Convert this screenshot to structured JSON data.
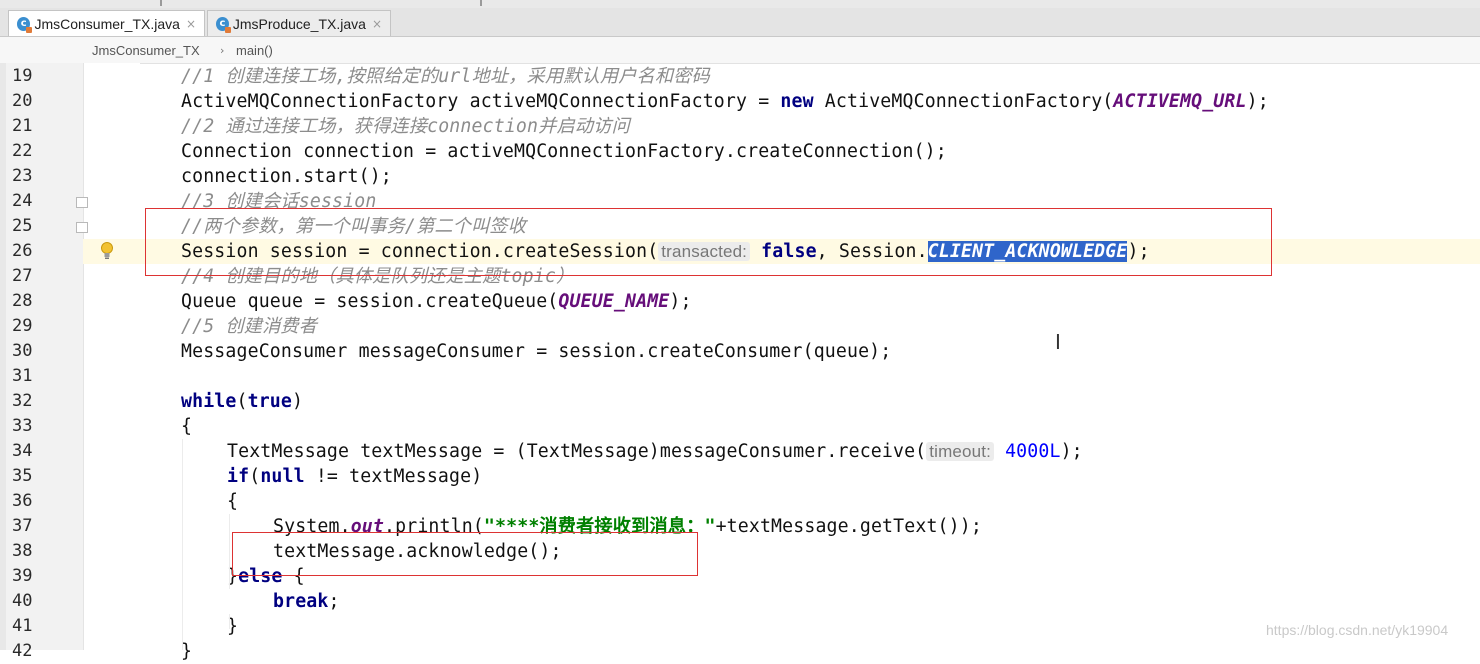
{
  "tabs": [
    {
      "label": "JmsConsumer_TX.java",
      "active": true
    },
    {
      "label": "JmsProduce_TX.java",
      "active": false
    }
  ],
  "tab_close_glyph": "×",
  "breadcrumb": {
    "class_name": "JmsConsumer_TX",
    "separator": "›",
    "method": "main()"
  },
  "lines": [
    {
      "n": "19",
      "indent": 0,
      "parts": [
        {
          "t": "//1 创建连接工场,按照给定的url地址，采用默认用户名和密码",
          "c": "cm"
        }
      ]
    },
    {
      "n": "20",
      "indent": 0,
      "parts": [
        {
          "t": "ActiveMQConnectionFactory activeMQConnectionFactory = "
        },
        {
          "t": "new",
          "c": "kw"
        },
        {
          "t": " ActiveMQConnectionFactory("
        },
        {
          "t": "ACTIVEMQ_URL",
          "c": "cst"
        },
        {
          "t": ");"
        }
      ]
    },
    {
      "n": "21",
      "indent": 0,
      "parts": [
        {
          "t": "//2 通过连接工场，获得连接connection并启动访问",
          "c": "cm"
        }
      ]
    },
    {
      "n": "22",
      "indent": 0,
      "parts": [
        {
          "t": "Connection connection = activeMQConnectionFactory.createConnection();"
        }
      ]
    },
    {
      "n": "23",
      "indent": 0,
      "parts": [
        {
          "t": "connection.start();"
        }
      ]
    },
    {
      "n": "24",
      "indent": 0,
      "parts": [
        {
          "t": "//3 创建会话session",
          "c": "cm"
        }
      ]
    },
    {
      "n": "25",
      "indent": 0,
      "parts": [
        {
          "t": "//两个参数，第一个叫事务/第二个叫签收",
          "c": "cm"
        }
      ]
    },
    {
      "n": "26",
      "indent": 0,
      "parts": [
        {
          "t": "Session session = connection.createSession("
        },
        {
          "t": "transacted:",
          "c": "hint"
        },
        {
          "t": " "
        },
        {
          "t": "false",
          "c": "kw"
        },
        {
          "t": ", Session."
        },
        {
          "t": "CLIENT_ACKNOWLEDGE",
          "c": "sel"
        },
        {
          "t": ");"
        }
      ]
    },
    {
      "n": "27",
      "indent": 0,
      "parts": [
        {
          "t": "//4 创建目的地（具体是队列还是主题topic）",
          "c": "cm"
        }
      ]
    },
    {
      "n": "28",
      "indent": 0,
      "parts": [
        {
          "t": "Queue queue = session.createQueue("
        },
        {
          "t": "QUEUE_NAME",
          "c": "cst"
        },
        {
          "t": ");"
        }
      ]
    },
    {
      "n": "29",
      "indent": 0,
      "parts": [
        {
          "t": "//5 创建消费者",
          "c": "cm"
        }
      ]
    },
    {
      "n": "30",
      "indent": 0,
      "parts": [
        {
          "t": "MessageConsumer messageConsumer = session.createConsumer(queue);"
        }
      ]
    },
    {
      "n": "31",
      "indent": 0,
      "parts": []
    },
    {
      "n": "32",
      "indent": 0,
      "parts": [
        {
          "t": "while",
          "c": "kw"
        },
        {
          "t": "("
        },
        {
          "t": "true",
          "c": "kw"
        },
        {
          "t": ")"
        }
      ]
    },
    {
      "n": "33",
      "indent": 0,
      "parts": [
        {
          "t": "{"
        }
      ]
    },
    {
      "n": "34",
      "indent": 1,
      "parts": [
        {
          "t": "TextMessage textMessage = (TextMessage)messageConsumer.receive("
        },
        {
          "t": "timeout:",
          "c": "hint"
        },
        {
          "t": " "
        },
        {
          "t": "4000L",
          "c": "num"
        },
        {
          "t": ");"
        }
      ]
    },
    {
      "n": "35",
      "indent": 1,
      "parts": [
        {
          "t": "if",
          "c": "kw"
        },
        {
          "t": "("
        },
        {
          "t": "null",
          "c": "kw"
        },
        {
          "t": " != textMessage)"
        }
      ]
    },
    {
      "n": "36",
      "indent": 1,
      "parts": [
        {
          "t": "{"
        }
      ]
    },
    {
      "n": "37",
      "indent": 2,
      "parts": [
        {
          "t": "System."
        },
        {
          "t": "out",
          "c": "fld"
        },
        {
          "t": ".println("
        },
        {
          "t": "\"****消费者接收到消息：\"",
          "c": "str"
        },
        {
          "t": "+textMessage.getText());"
        }
      ]
    },
    {
      "n": "38",
      "indent": 2,
      "parts": [
        {
          "t": "textMessage.acknowledge();"
        }
      ]
    },
    {
      "n": "39",
      "indent": 1,
      "parts": [
        {
          "t": "}"
        },
        {
          "t": "else",
          "c": "kw"
        },
        {
          "t": " {"
        }
      ]
    },
    {
      "n": "40",
      "indent": 2,
      "parts": [
        {
          "t": "break",
          "c": "kw"
        },
        {
          "t": ";"
        }
      ]
    },
    {
      "n": "41",
      "indent": 1,
      "parts": [
        {
          "t": "}"
        }
      ]
    },
    {
      "n": "42",
      "indent": 0,
      "parts": [
        {
          "t": "}"
        }
      ]
    }
  ],
  "watermark": "https://blog.csdn.net/yk19904"
}
